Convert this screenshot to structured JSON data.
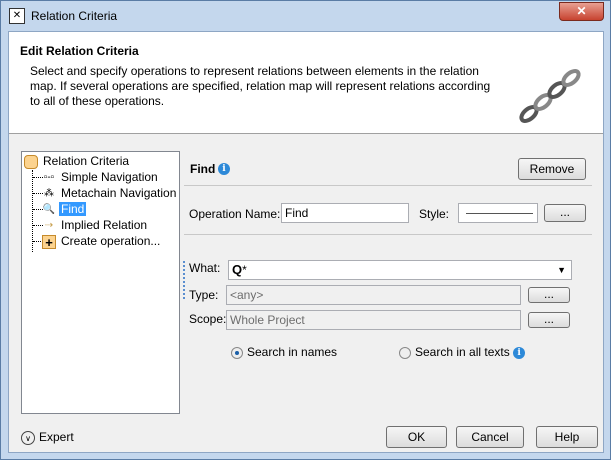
{
  "window": {
    "title": "Relation Criteria",
    "close": "✕"
  },
  "header": {
    "title": "Edit Relation Criteria",
    "description": "Select and specify operations to represent relations between elements in the relation map. If several operations are specified, relation map will represent relations according to all of these operations."
  },
  "tree": {
    "root": "Relation Criteria",
    "items": [
      {
        "label": "Simple Navigation"
      },
      {
        "label": "Metachain Navigation"
      },
      {
        "label": "Find"
      },
      {
        "label": "Implied Relation"
      },
      {
        "label": "Create operation..."
      }
    ]
  },
  "panel": {
    "title": "Find",
    "remove": "Remove",
    "op_name_label": "Operation Name:",
    "op_name_value": "Find",
    "style_label": "Style:",
    "ellipsis": "...",
    "what_label": "What:",
    "what_value": "*",
    "type_label": "Type:",
    "type_value": "<any>",
    "scope_label": "Scope:",
    "scope_value": "Whole Project",
    "radio_names": "Search in names",
    "radio_all": "Search in all texts"
  },
  "footer": {
    "expert": "Expert",
    "ok": "OK",
    "cancel": "Cancel",
    "help": "Help"
  }
}
